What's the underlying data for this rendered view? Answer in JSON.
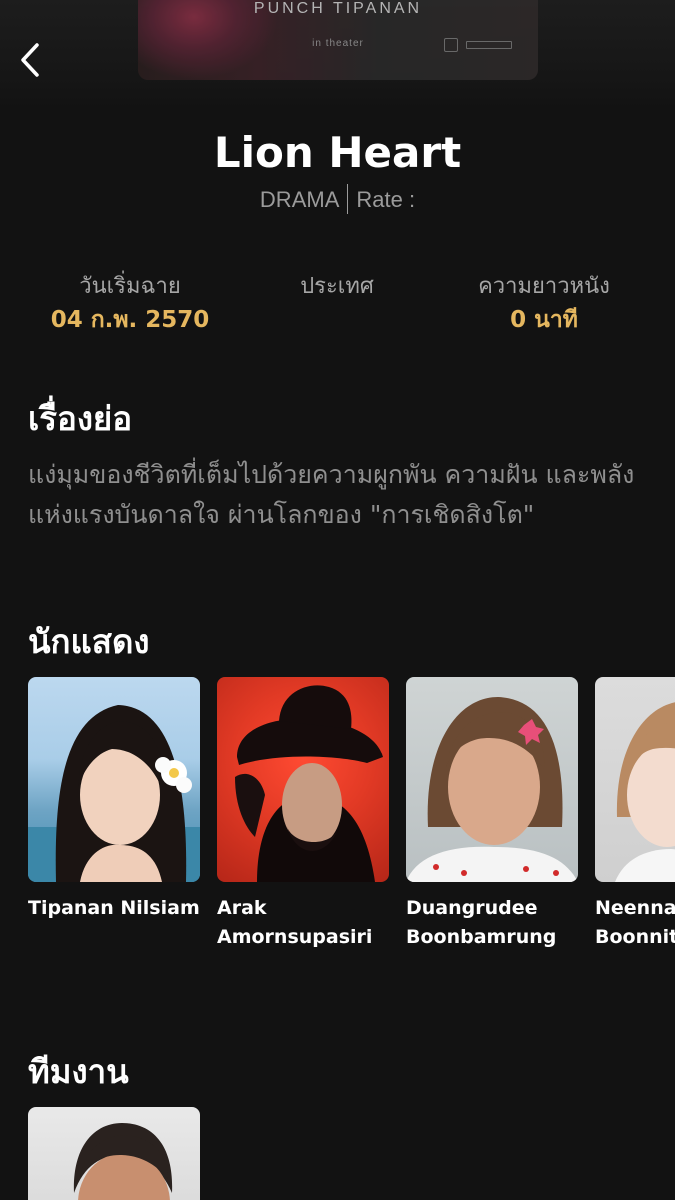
{
  "poster": {
    "title": "PUNCH TIPANAN",
    "subtitle": "in theater"
  },
  "movie": {
    "title": "Lion Heart",
    "genre": "DRAMA",
    "rate_label": "Rate :"
  },
  "stats": {
    "release": {
      "label": "วันเริ่มฉาย",
      "value": "04 ก.พ. 2570"
    },
    "country": {
      "label": "ประเทศ",
      "value": ""
    },
    "duration": {
      "label": "ความยาวหนัง",
      "value": "0 นาที"
    }
  },
  "synopsis": {
    "heading": "เรื่องย่อ",
    "text": "แง่มุมของชีวิตที่เต็มไปด้วยความผูกพัน ความฝัน และพลังแห่งแรงบันดาลใจ ผ่านโลกของ \"การเชิดสิงโต\""
  },
  "cast": {
    "heading": "นักแสดง",
    "members": [
      {
        "line1": "Tipanan Nilsiam",
        "line2": ""
      },
      {
        "line1": "Arak",
        "line2": "Amornsupasiri"
      },
      {
        "line1": "Duangrudee",
        "line2": "Boonbamrung"
      },
      {
        "line1": "Neenna",
        "line2": "Boonnit"
      }
    ]
  },
  "crew": {
    "heading": "ทีมงาน"
  },
  "icons": {
    "back": "chevron-left-icon"
  },
  "colors": {
    "background": "#121212",
    "accent": "#e5b75f",
    "muted_text": "#8f8f8f"
  }
}
